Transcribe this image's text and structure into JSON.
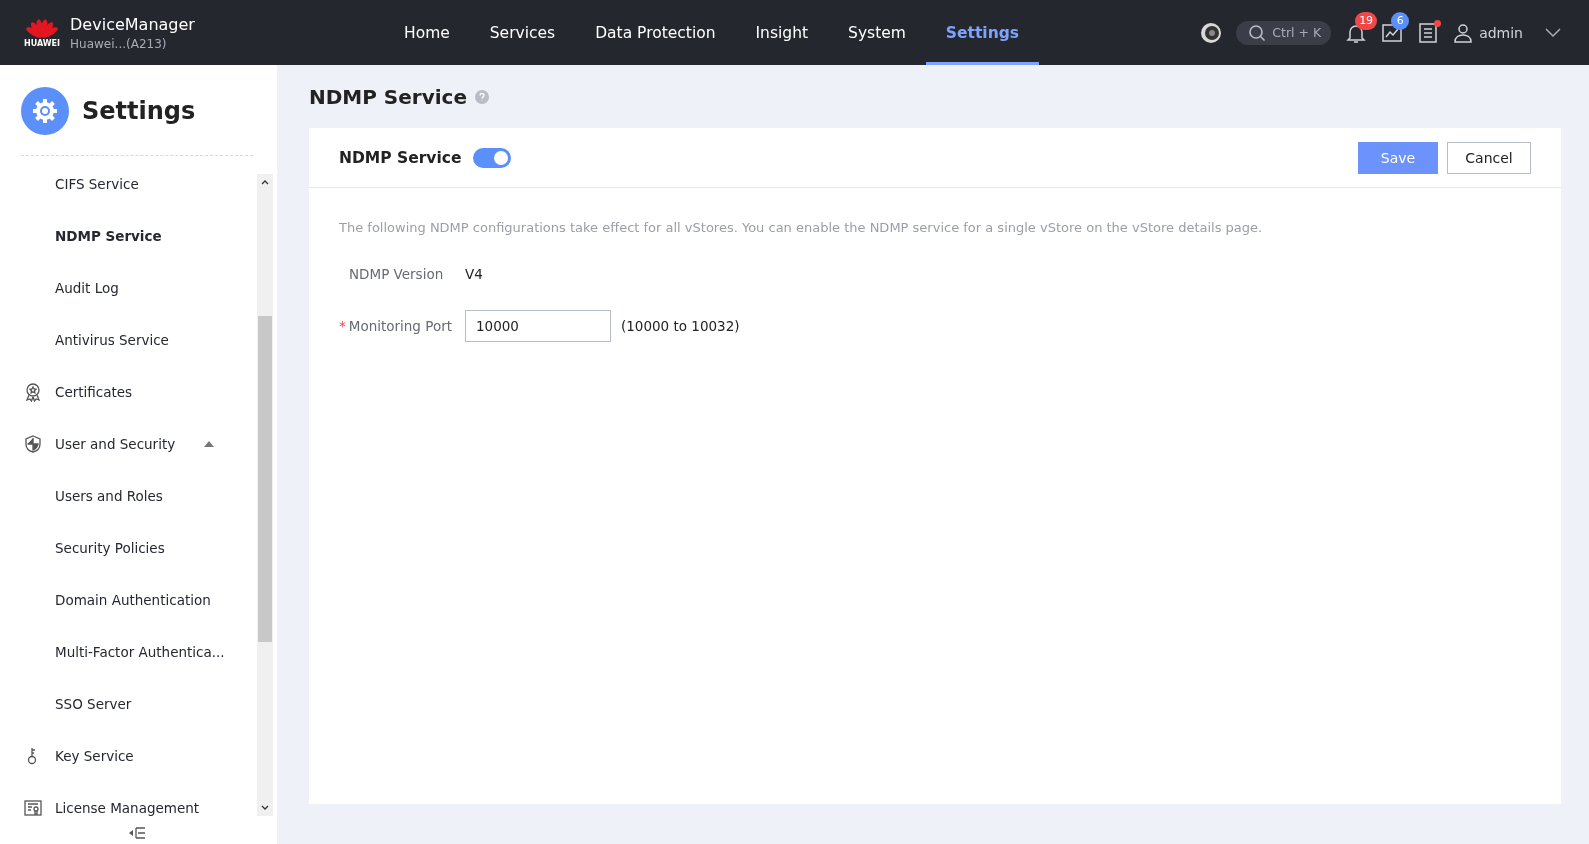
{
  "brand": {
    "logo_text": "HUAWEI",
    "title": "DeviceManager",
    "subtitle": "Huawei...(A213)"
  },
  "nav": [
    {
      "label": "Home",
      "selected": false
    },
    {
      "label": "Services",
      "selected": false
    },
    {
      "label": "Data Protection",
      "selected": false
    },
    {
      "label": "Insight",
      "selected": false
    },
    {
      "label": "System",
      "selected": false
    },
    {
      "label": "Settings",
      "selected": true
    }
  ],
  "search": {
    "placeholder": "Ctrl + K"
  },
  "alerts": {
    "notifications": "19",
    "tasks": "6",
    "messages_unread": true
  },
  "user": {
    "name": "admin"
  },
  "sidebar": {
    "title": "Settings",
    "items": [
      {
        "label": "CIFS Service",
        "selected": false
      },
      {
        "label": "NDMP Service",
        "selected": true
      },
      {
        "label": "Audit Log",
        "selected": false
      },
      {
        "label": "Antivirus Service",
        "selected": false
      },
      {
        "label": "Certificates",
        "kind": "certificate",
        "selected": false
      },
      {
        "label": "User and Security",
        "kind": "shield",
        "selected": false,
        "expanded": true,
        "children": [
          {
            "label": "Users and Roles",
            "selected": false
          },
          {
            "label": "Security Policies",
            "selected": false
          },
          {
            "label": "Domain Authentication",
            "selected": false
          },
          {
            "label": "Multi-Factor Authentica...",
            "selected": false
          },
          {
            "label": "SSO Server",
            "selected": false
          }
        ]
      },
      {
        "label": "Key Service",
        "kind": "key",
        "selected": false
      },
      {
        "label": "License Management",
        "kind": "license",
        "selected": false
      }
    ]
  },
  "page": {
    "title": "NDMP Service",
    "card": {
      "toggle_label": "NDMP Service",
      "on": true,
      "buttons": [
        {
          "label": "Save",
          "kind": "primary"
        },
        {
          "label": "Cancel",
          "kind": "secondary"
        }
      ],
      "description": "The following NDMP configurations take effect for all vStores. You can enable the NDMP service for a single vStore on the vStore details page.",
      "fields": [
        {
          "label": "NDMP Version",
          "kind": "text",
          "value": "V4"
        },
        {
          "label": "Monitoring Port",
          "kind": "input",
          "value": "10000",
          "marker": "*",
          "hint": "(10000 to 10032)"
        }
      ]
    }
  }
}
